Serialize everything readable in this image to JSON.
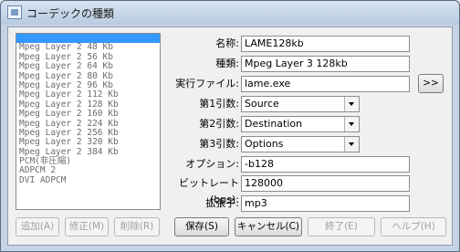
{
  "window": {
    "title": "コーデックの種類"
  },
  "codec_list": {
    "items": [
      "",
      "Mpeg Layer 2 48 Kb",
      "Mpeg Layer 2 56 Kb",
      "Mpeg Layer 2 64 Kb",
      "Mpeg Layer 2 80 Kb",
      "Mpeg Layer 2 96 Kb",
      "Mpeg Layer 2 112 Kb",
      "Mpeg Layer 2 128 Kb",
      "Mpeg Layer 2 160 Kb",
      "Mpeg Layer 2 224 Kb",
      "Mpeg Layer 2 256 Kb",
      "Mpeg Layer 2 320 Kb",
      "Mpeg Layer 2 384 Kb",
      "PCM(非圧縮)",
      "ADPCM 2",
      "DVI ADPCM"
    ],
    "selected_index": 0
  },
  "form": {
    "name_label": "名称:",
    "name_value": "LAME128kb",
    "type_label": "種類:",
    "type_value": "Mpeg Layer 3 128kb",
    "exe_label": "実行ファイル:",
    "exe_value": "lame.exe",
    "browse_label": ">>",
    "arg1_label": "第1引数:",
    "arg1_value": "Source",
    "arg2_label": "第2引数:",
    "arg2_value": "Destination",
    "arg3_label": "第3引数:",
    "arg3_value": "Options",
    "option_label": "オプション:",
    "option_value": "-b128",
    "bitrate_label": "ビットレート (bps):",
    "bitrate_value": "128000",
    "ext_label": "拡張子:",
    "ext_value": "mp3"
  },
  "buttons": {
    "add": "追加(A)",
    "modify": "修正(M)",
    "delete": "削除(R)",
    "save": "保存(S)",
    "cancel": "キャンセル(C)",
    "finish": "終了(E)",
    "help": "ヘルプ(H)"
  }
}
